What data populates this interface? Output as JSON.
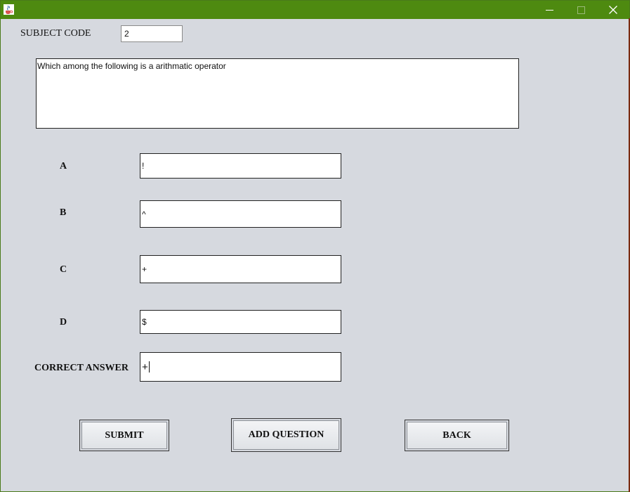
{
  "window": {
    "title": "",
    "icons": {
      "app": "java-cup-icon",
      "minimize": "minimize-icon",
      "maximize": "maximize-icon",
      "close": "close-icon"
    },
    "colors": {
      "titlebar": "#4e8a10",
      "background": "#d6d9df"
    }
  },
  "subject": {
    "label": "SUBJECT CODE",
    "value": "2"
  },
  "question": {
    "text": "Which among the following is a arithmatic operator"
  },
  "options": [
    {
      "label": "A",
      "value": "!"
    },
    {
      "label": "B",
      "value": "^"
    },
    {
      "label": "C",
      "value": "+"
    },
    {
      "label": "D",
      "value": "$"
    }
  ],
  "correct": {
    "label": "CORRECT ANSWER",
    "value": "+"
  },
  "buttons": {
    "submit": "SUBMIT",
    "add_question": "ADD QUESTION",
    "back": "BACK"
  }
}
